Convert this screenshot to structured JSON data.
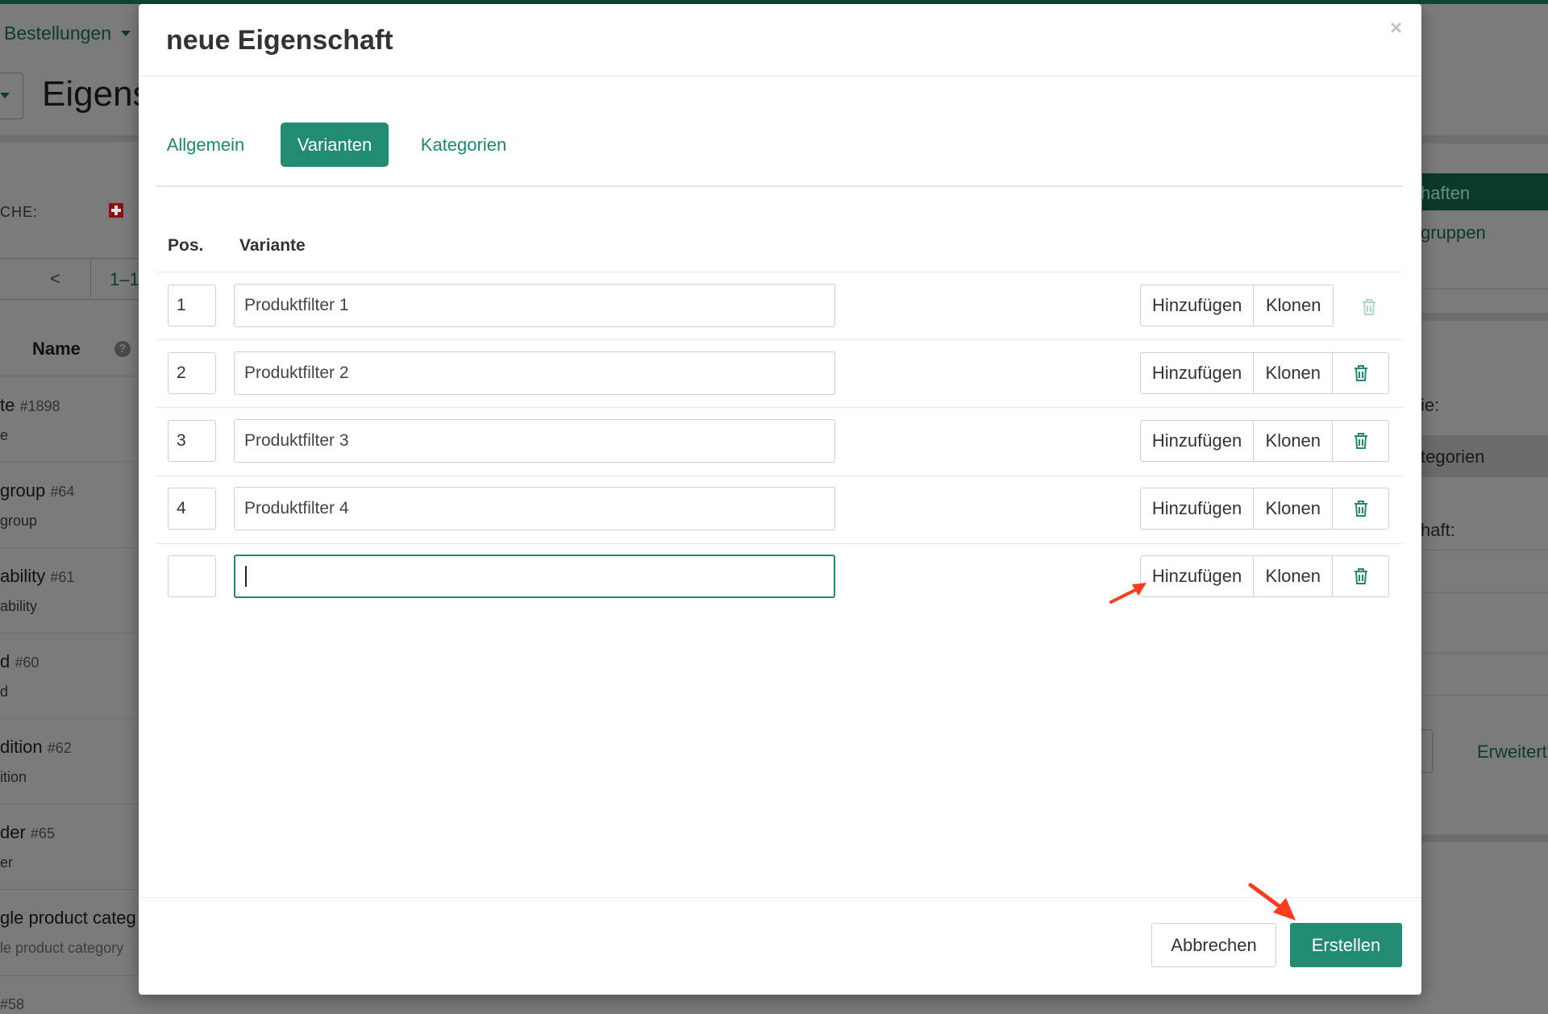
{
  "background": {
    "nav": {
      "orders_label": "Bestellungen"
    },
    "page_title": "Eigens",
    "language_label": "CHE:",
    "pager": {
      "prev": "<",
      "range": "1–1"
    },
    "list": {
      "column_name": "Name",
      "rows": [
        {
          "title": "te",
          "id": "#1898",
          "sub": "e"
        },
        {
          "title": "group",
          "id": "#64",
          "sub": "group"
        },
        {
          "title": "ability",
          "id": "#61",
          "sub": "ability"
        },
        {
          "title": "d",
          "id": "#60",
          "sub": "d"
        },
        {
          "title": "dition",
          "id": "#62",
          "sub": "ition"
        },
        {
          "title": "der",
          "id": "#65",
          "sub": "er"
        },
        {
          "title": "gle product categ",
          "id": "",
          "sub": "le product category"
        },
        {
          "title": "",
          "id": "#58",
          "sub": ""
        }
      ]
    },
    "right_panel": {
      "header": "haften",
      "groups": "gruppen",
      "field_ie": "ie:",
      "categories": "tegorien",
      "field_schaft": "haft:",
      "advanced": "Erweitert"
    }
  },
  "modal": {
    "title": "neue Eigenschaft",
    "close": "×",
    "tabs": [
      {
        "label": "Allgemein",
        "active": false
      },
      {
        "label": "Varianten",
        "active": true
      },
      {
        "label": "Kategorien",
        "active": false
      }
    ],
    "table": {
      "col_pos": "Pos.",
      "col_variant": "Variante",
      "rows": [
        {
          "pos": "1",
          "name": "Produktfilter 1",
          "delete_enabled": false
        },
        {
          "pos": "2",
          "name": "Produktfilter 2",
          "delete_enabled": true
        },
        {
          "pos": "3",
          "name": "Produktfilter 3",
          "delete_enabled": true
        },
        {
          "pos": "4",
          "name": "Produktfilter 4",
          "delete_enabled": true
        },
        {
          "pos": "",
          "name": "",
          "delete_enabled": true,
          "focused": true
        }
      ],
      "add_label": "Hinzufügen",
      "clone_label": "Klonen"
    },
    "footer": {
      "cancel_label": "Abbrechen",
      "create_label": "Erstellen"
    }
  },
  "colors": {
    "accent": "#218c71",
    "annotation_arrow": "#ff3b1f"
  }
}
